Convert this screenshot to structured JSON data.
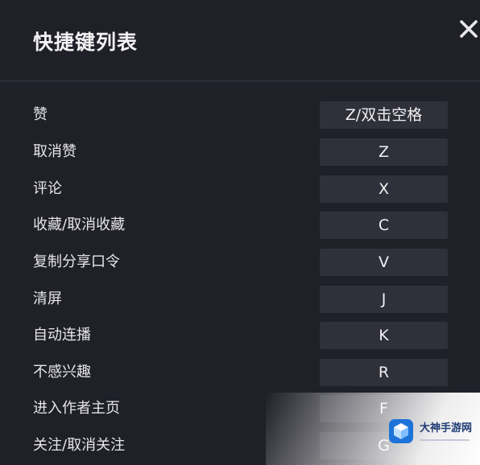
{
  "dialog": {
    "title": "快捷键列表",
    "close_icon": "close-icon",
    "shortcuts": [
      {
        "action": "赞",
        "key": "Z/双击空格"
      },
      {
        "action": "取消赞",
        "key": "Z"
      },
      {
        "action": "评论",
        "key": "X"
      },
      {
        "action": "收藏/取消收藏",
        "key": "C"
      },
      {
        "action": "复制分享口令",
        "key": "V"
      },
      {
        "action": "清屏",
        "key": "J"
      },
      {
        "action": "自动连播",
        "key": "K"
      },
      {
        "action": "不感兴趣",
        "key": "R"
      },
      {
        "action": "进入作者主页",
        "key": "F"
      },
      {
        "action": "关注/取消关注",
        "key": "G"
      }
    ]
  },
  "watermark": {
    "brand": "大神手游网",
    "logo_icon": "cube-logo-icon"
  },
  "colors": {
    "background": "#1f2028",
    "key_background": "#2f3039",
    "text": "#e6e6ea",
    "title": "#f2f2f4"
  }
}
